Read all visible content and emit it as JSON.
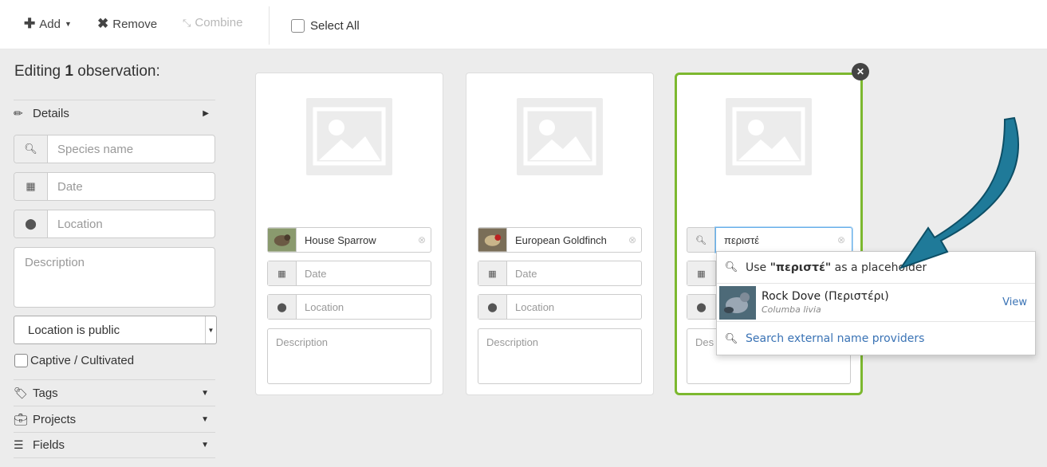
{
  "toolbar": {
    "add_label": "Add",
    "remove_label": "Remove",
    "combine_label": "Combine",
    "select_all_label": "Select All"
  },
  "sidebar": {
    "editing_prefix": "Editing",
    "editing_count": "1",
    "editing_suffix": "observation:",
    "details_label": "Details",
    "species_placeholder": "Species name",
    "date_placeholder": "Date",
    "location_placeholder": "Location",
    "description_placeholder": "Description",
    "location_privacy": "Location is public",
    "captive_label": "Captive / Cultivated",
    "tags_label": "Tags",
    "projects_label": "Projects",
    "fields_label": "Fields"
  },
  "cards": [
    {
      "species": "House Sparrow",
      "date_placeholder": "Date",
      "location_placeholder": "Location",
      "description_placeholder": "Description"
    },
    {
      "species": "European Goldfinch",
      "date_placeholder": "Date",
      "location_placeholder": "Location",
      "description_placeholder": "Description"
    },
    {
      "species_input": "περιστέ",
      "description_placeholder": "Des"
    }
  ],
  "dropdown": {
    "use_prefix": "Use ",
    "use_term": "\"περιστέ\"",
    "use_suffix": " as a placeholder",
    "result_common": "Rock Dove (Περιστέρι)",
    "result_scientific": "Columba livia",
    "view_label": "View",
    "search_external": "Search external name providers"
  },
  "colors": {
    "selected_border": "#7cb82f",
    "link": "#3a73b5",
    "arrow": "#1f7a99"
  },
  "icons": [
    "plus-icon",
    "caret-down-icon",
    "times-icon",
    "combine-icon",
    "pencil-icon",
    "search-icon",
    "calendar-icon",
    "map-marker-icon",
    "tag-icon",
    "briefcase-icon",
    "list-icon",
    "close-icon",
    "arrow-annotation"
  ]
}
